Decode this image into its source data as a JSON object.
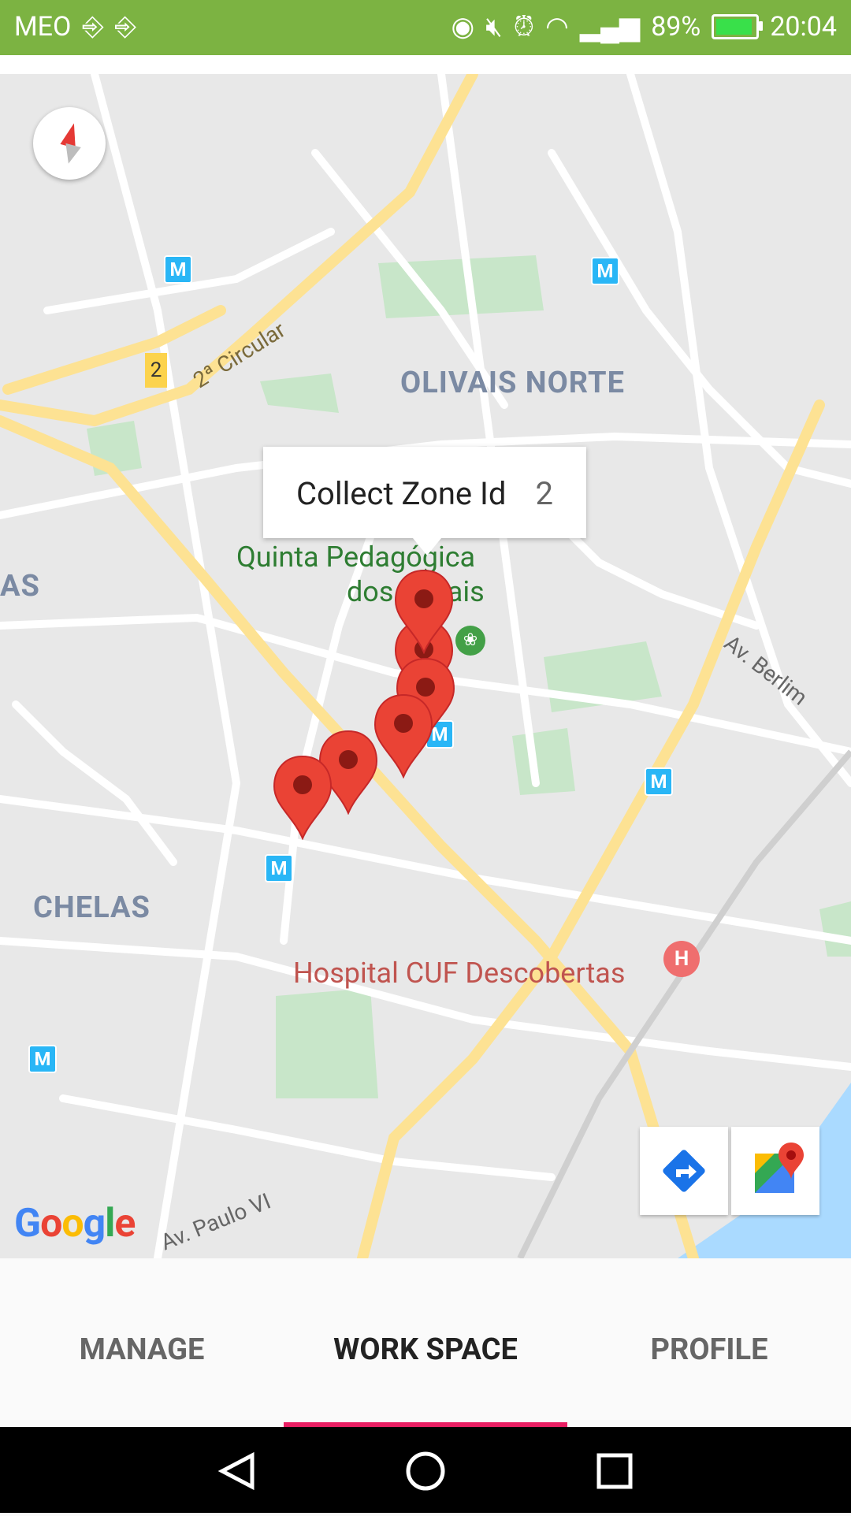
{
  "status_bar": {
    "carrier": "MEO",
    "battery_percent": "89%",
    "time": "20:04"
  },
  "map": {
    "tooltip": {
      "title": "Collect Zone Id",
      "value": "2"
    },
    "labels": {
      "area1": "OLIVAIS NORTE",
      "area2": "CHELAS",
      "area3": "AS",
      "park": "Quinta Pedagógica",
      "park2": "dos Olivais",
      "hospital": "Hospital CUF Descobertas",
      "road1": "2ª Circular",
      "road2": "Av. Berlim",
      "road3": "Av. Paulo VI",
      "route_badge": "2"
    },
    "metro_symbol": "M",
    "google_logo": "Google"
  },
  "tabs": {
    "manage": "MANAGE",
    "work_space": "WORK SPACE",
    "profile": "PROFILE",
    "active": "WORK SPACE"
  },
  "colors": {
    "status_bar": "#7cb342",
    "tab_indicator": "#e91e63",
    "pin": "#ea4335"
  }
}
